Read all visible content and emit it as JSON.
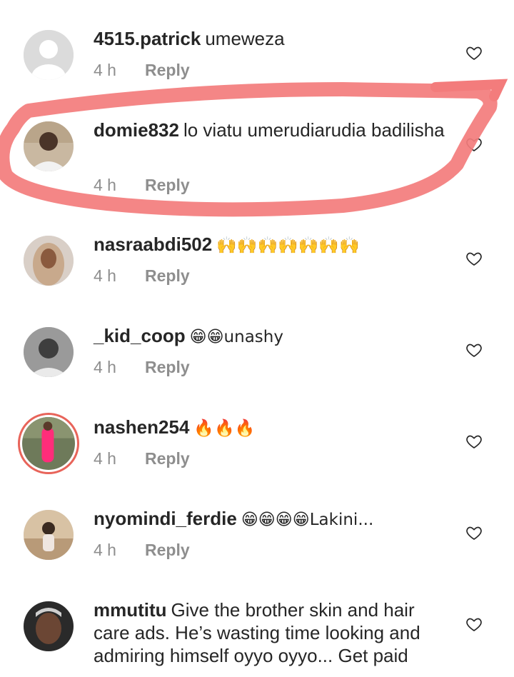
{
  "comments": [
    {
      "username": "4515.patrick",
      "text": "umeweza",
      "time": "4 h",
      "reply": "Reply",
      "avatar": "default-avatar"
    },
    {
      "username": "domie832",
      "text": "lo viatu umerudiarudia badilisha",
      "time": "4 h",
      "reply": "Reply",
      "avatar": "profile-photo"
    },
    {
      "username": "nasraabdi502",
      "text": "🙌🙌🙌🙌🙌🙌🙌",
      "time": "4 h",
      "reply": "Reply",
      "avatar": "profile-photo"
    },
    {
      "username": "_kid_coop",
      "text": "😁😁unashy",
      "time": "4 h",
      "reply": "Reply",
      "avatar": "profile-photo"
    },
    {
      "username": "nashen254",
      "text": "🔥🔥🔥",
      "time": "4 h",
      "reply": "Reply",
      "avatar": "profile-photo-story-ring"
    },
    {
      "username": "nyomindi_ferdie",
      "text": "😁😁😁😁Lakini...",
      "time": "4 h",
      "reply": "Reply",
      "avatar": "profile-photo"
    },
    {
      "username": "mmutitu",
      "text": "Give the brother skin and hair care ads. He’s wasting time looking and admiring himself oyyo oyyo... Get paid",
      "avatar": "profile-photo"
    }
  ],
  "colors": {
    "annotation": "#f37c7c",
    "meta": "#8e8e8e",
    "text": "#262626",
    "heart": "#262626"
  }
}
